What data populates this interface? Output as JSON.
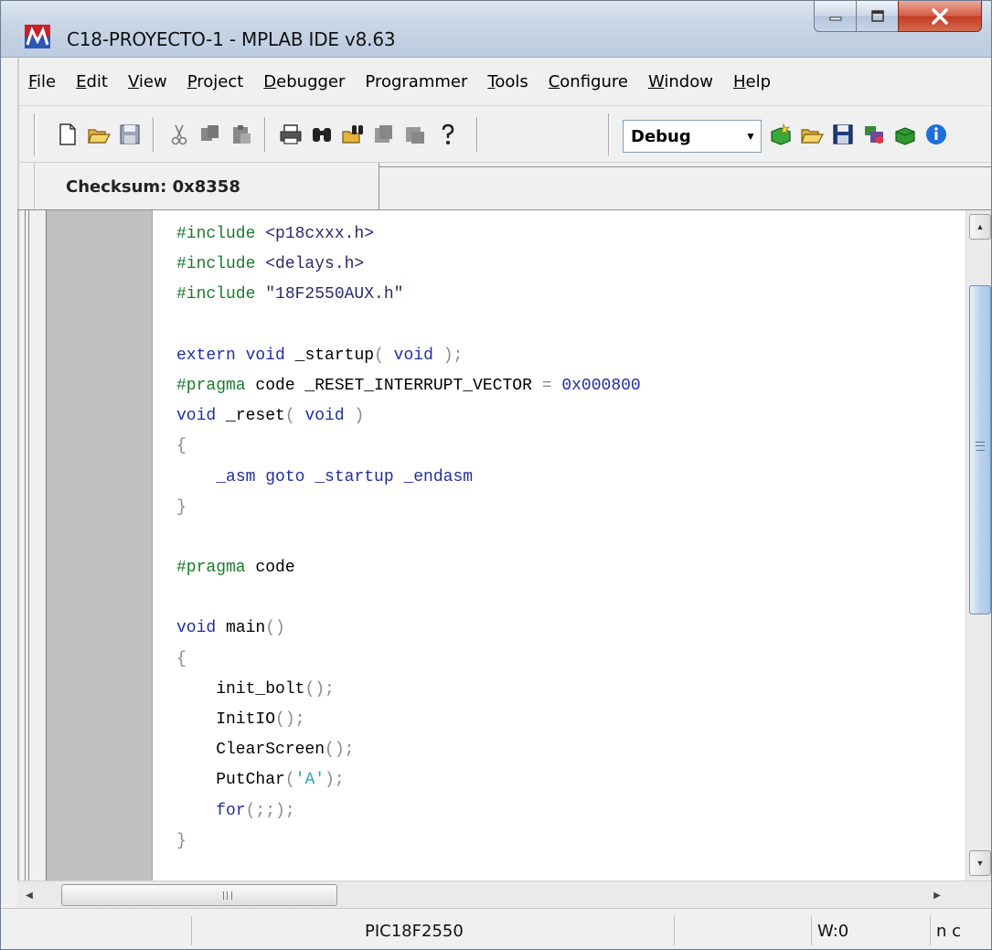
{
  "window": {
    "title": "C18-PROYECTO-1 - MPLAB IDE v8.63"
  },
  "menu": [
    {
      "label": "File",
      "accel": "F",
      "rest": "ile"
    },
    {
      "label": "Edit",
      "accel": "E",
      "rest": "dit"
    },
    {
      "label": "View",
      "accel": "V",
      "rest": "iew"
    },
    {
      "label": "Project",
      "accel": "P",
      "rest": "roject"
    },
    {
      "label": "Debugger",
      "accel": "D",
      "rest": "ebugger"
    },
    {
      "label": "Programmer",
      "accel": "",
      "rest": "Programmer"
    },
    {
      "label": "Tools",
      "accel": "T",
      "rest": "ools"
    },
    {
      "label": "Configure",
      "accel": "C",
      "rest": "onfigure"
    },
    {
      "label": "Window",
      "accel": "W",
      "rest": "indow"
    },
    {
      "label": "Help",
      "accel": "H",
      "rest": "elp"
    }
  ],
  "toolbar": {
    "build_configuration": "Debug"
  },
  "tab": {
    "checksum_label": "Checksum:  0x8358"
  },
  "code_lines": [
    [
      [
        "pp",
        "#include "
      ],
      [
        "str",
        "<p18cxxx.h>"
      ]
    ],
    [
      [
        "pp",
        "#include "
      ],
      [
        "str",
        "<delays.h>"
      ]
    ],
    [
      [
        "pp",
        "#include "
      ],
      [
        "str",
        "\"18F2550AUX.h\""
      ]
    ],
    [],
    [
      [
        "kw",
        "extern"
      ],
      [
        "",
        " "
      ],
      [
        "kw",
        "void"
      ],
      [
        "",
        " _startup"
      ],
      [
        "punc",
        "( "
      ],
      [
        "kw",
        "void"
      ],
      [
        "punc",
        " );"
      ]
    ],
    [
      [
        "pp",
        "#pragma"
      ],
      [
        "",
        " code _RESET_INTERRUPT_VECTOR "
      ],
      [
        "punc",
        "="
      ],
      [
        "",
        " "
      ],
      [
        "num",
        "0x000800"
      ]
    ],
    [
      [
        "kw",
        "void"
      ],
      [
        "",
        " _reset"
      ],
      [
        "punc",
        "( "
      ],
      [
        "kw",
        "void"
      ],
      [
        "punc",
        " )"
      ]
    ],
    [
      [
        "punc",
        "{"
      ]
    ],
    [
      [
        "",
        "    "
      ],
      [
        "kw",
        "_asm goto _startup _endasm"
      ]
    ],
    [
      [
        "punc",
        "}"
      ]
    ],
    [],
    [
      [
        "pp",
        "#pragma"
      ],
      [
        "",
        " code"
      ]
    ],
    [],
    [
      [
        "kw",
        "void"
      ],
      [
        "",
        " main"
      ],
      [
        "punc",
        "()"
      ]
    ],
    [
      [
        "punc",
        "{"
      ]
    ],
    [
      [
        "",
        "    init_bolt"
      ],
      [
        "punc",
        "();"
      ]
    ],
    [
      [
        "",
        "    InitIO"
      ],
      [
        "punc",
        "();"
      ]
    ],
    [
      [
        "",
        "    ClearScreen"
      ],
      [
        "punc",
        "();"
      ]
    ],
    [
      [
        "",
        "    PutChar"
      ],
      [
        "punc",
        "("
      ],
      [
        "chr",
        "'A'"
      ],
      [
        "punc",
        ");"
      ]
    ],
    [
      [
        "",
        "    "
      ],
      [
        "kw",
        "for"
      ],
      [
        "punc",
        "(;;);"
      ]
    ],
    [
      [
        "punc",
        "}"
      ]
    ]
  ],
  "statusbar": {
    "device": "PIC18F2550",
    "wreg": "W:0",
    "status_flags": "n c"
  },
  "hscroll_grip": "III",
  "icons": {
    "app": "mplab-icon",
    "minimize": "minimize-icon",
    "maximize": "maximize-icon",
    "close": "close-icon"
  }
}
